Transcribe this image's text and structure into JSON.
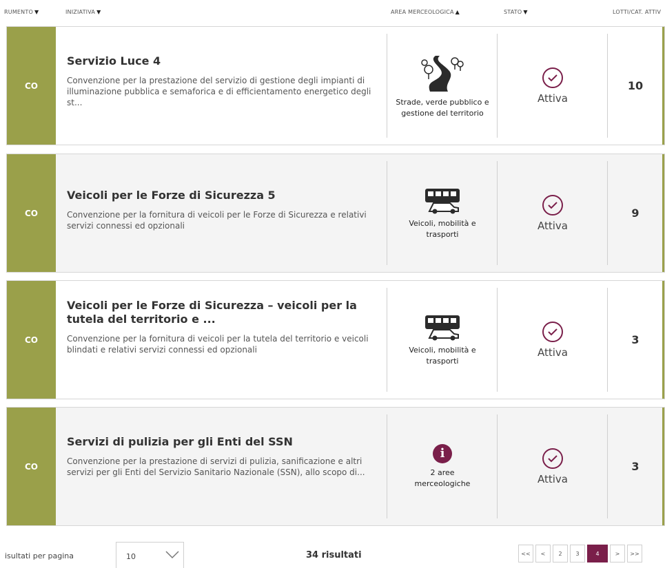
{
  "header": {
    "columns": [
      {
        "label": "RUMENTO",
        "sort": "▼"
      },
      {
        "label": "INIZIATIVA",
        "sort": "▼"
      },
      {
        "label": "AREA MERCEOLOGICA",
        "sort": "▲"
      },
      {
        "label": "STATO",
        "sort": "▼"
      },
      {
        "label": "LOTTI/CAT. ATTIV",
        "sort": ""
      }
    ]
  },
  "rows": [
    {
      "tipo": "CO",
      "title": "Servizio Luce 4",
      "desc": "Convenzione per la prestazione del servizio di gestione degli impianti di illuminazione pubblica e semaforica e di efficientamento energetico degli st...",
      "area_icon": "road-trees-icon",
      "area_label": "Strade, verde pubblico e gestione del territorio",
      "stato": "Attiva",
      "lotti": "10"
    },
    {
      "tipo": "CO",
      "title": "Veicoli per le Forze di Sicurezza 5",
      "desc": "Convenzione per la fornitura di veicoli per le Forze di Sicurezza e relativi servizi connessi ed opzionali",
      "area_icon": "bus-car-icon",
      "area_label": "Veicoli, mobilità e trasporti",
      "stato": "Attiva",
      "lotti": "9"
    },
    {
      "tipo": "CO",
      "title": "Veicoli per le Forze di Sicurezza – veicoli per la tutela del territorio e ...",
      "desc": "Convenzione per la fornitura di veicoli per la tutela del territorio e veicoli blindati e relativi servizi connessi ed opzionali",
      "area_icon": "bus-car-icon",
      "area_label": "Veicoli, mobilità e trasporti",
      "stato": "Attiva",
      "lotti": "3"
    },
    {
      "tipo": "CO",
      "title": "Servizi di pulizia per gli Enti del SSN",
      "desc": "Convenzione per la prestazione di servizi di pulizia, sanificazione e altri servizi per gli Enti del Servizio Sanitario Nazionale (SSN), allo scopo di...",
      "area_icon": "info-icon",
      "area_info_glyph": "i",
      "area_label": "2 aree merceologiche",
      "stato": "Attiva",
      "lotti": "3"
    }
  ],
  "footer": {
    "per_page_label": "isultati per pagina",
    "per_page_value": "10",
    "results": "34 risultati",
    "pages": [
      "<<",
      "<",
      "2",
      "3",
      "4",
      ">",
      ">>"
    ],
    "current_page": "4"
  },
  "colors": {
    "accent_green": "#9aa04a",
    "accent_purple": "#7a1f4a"
  }
}
